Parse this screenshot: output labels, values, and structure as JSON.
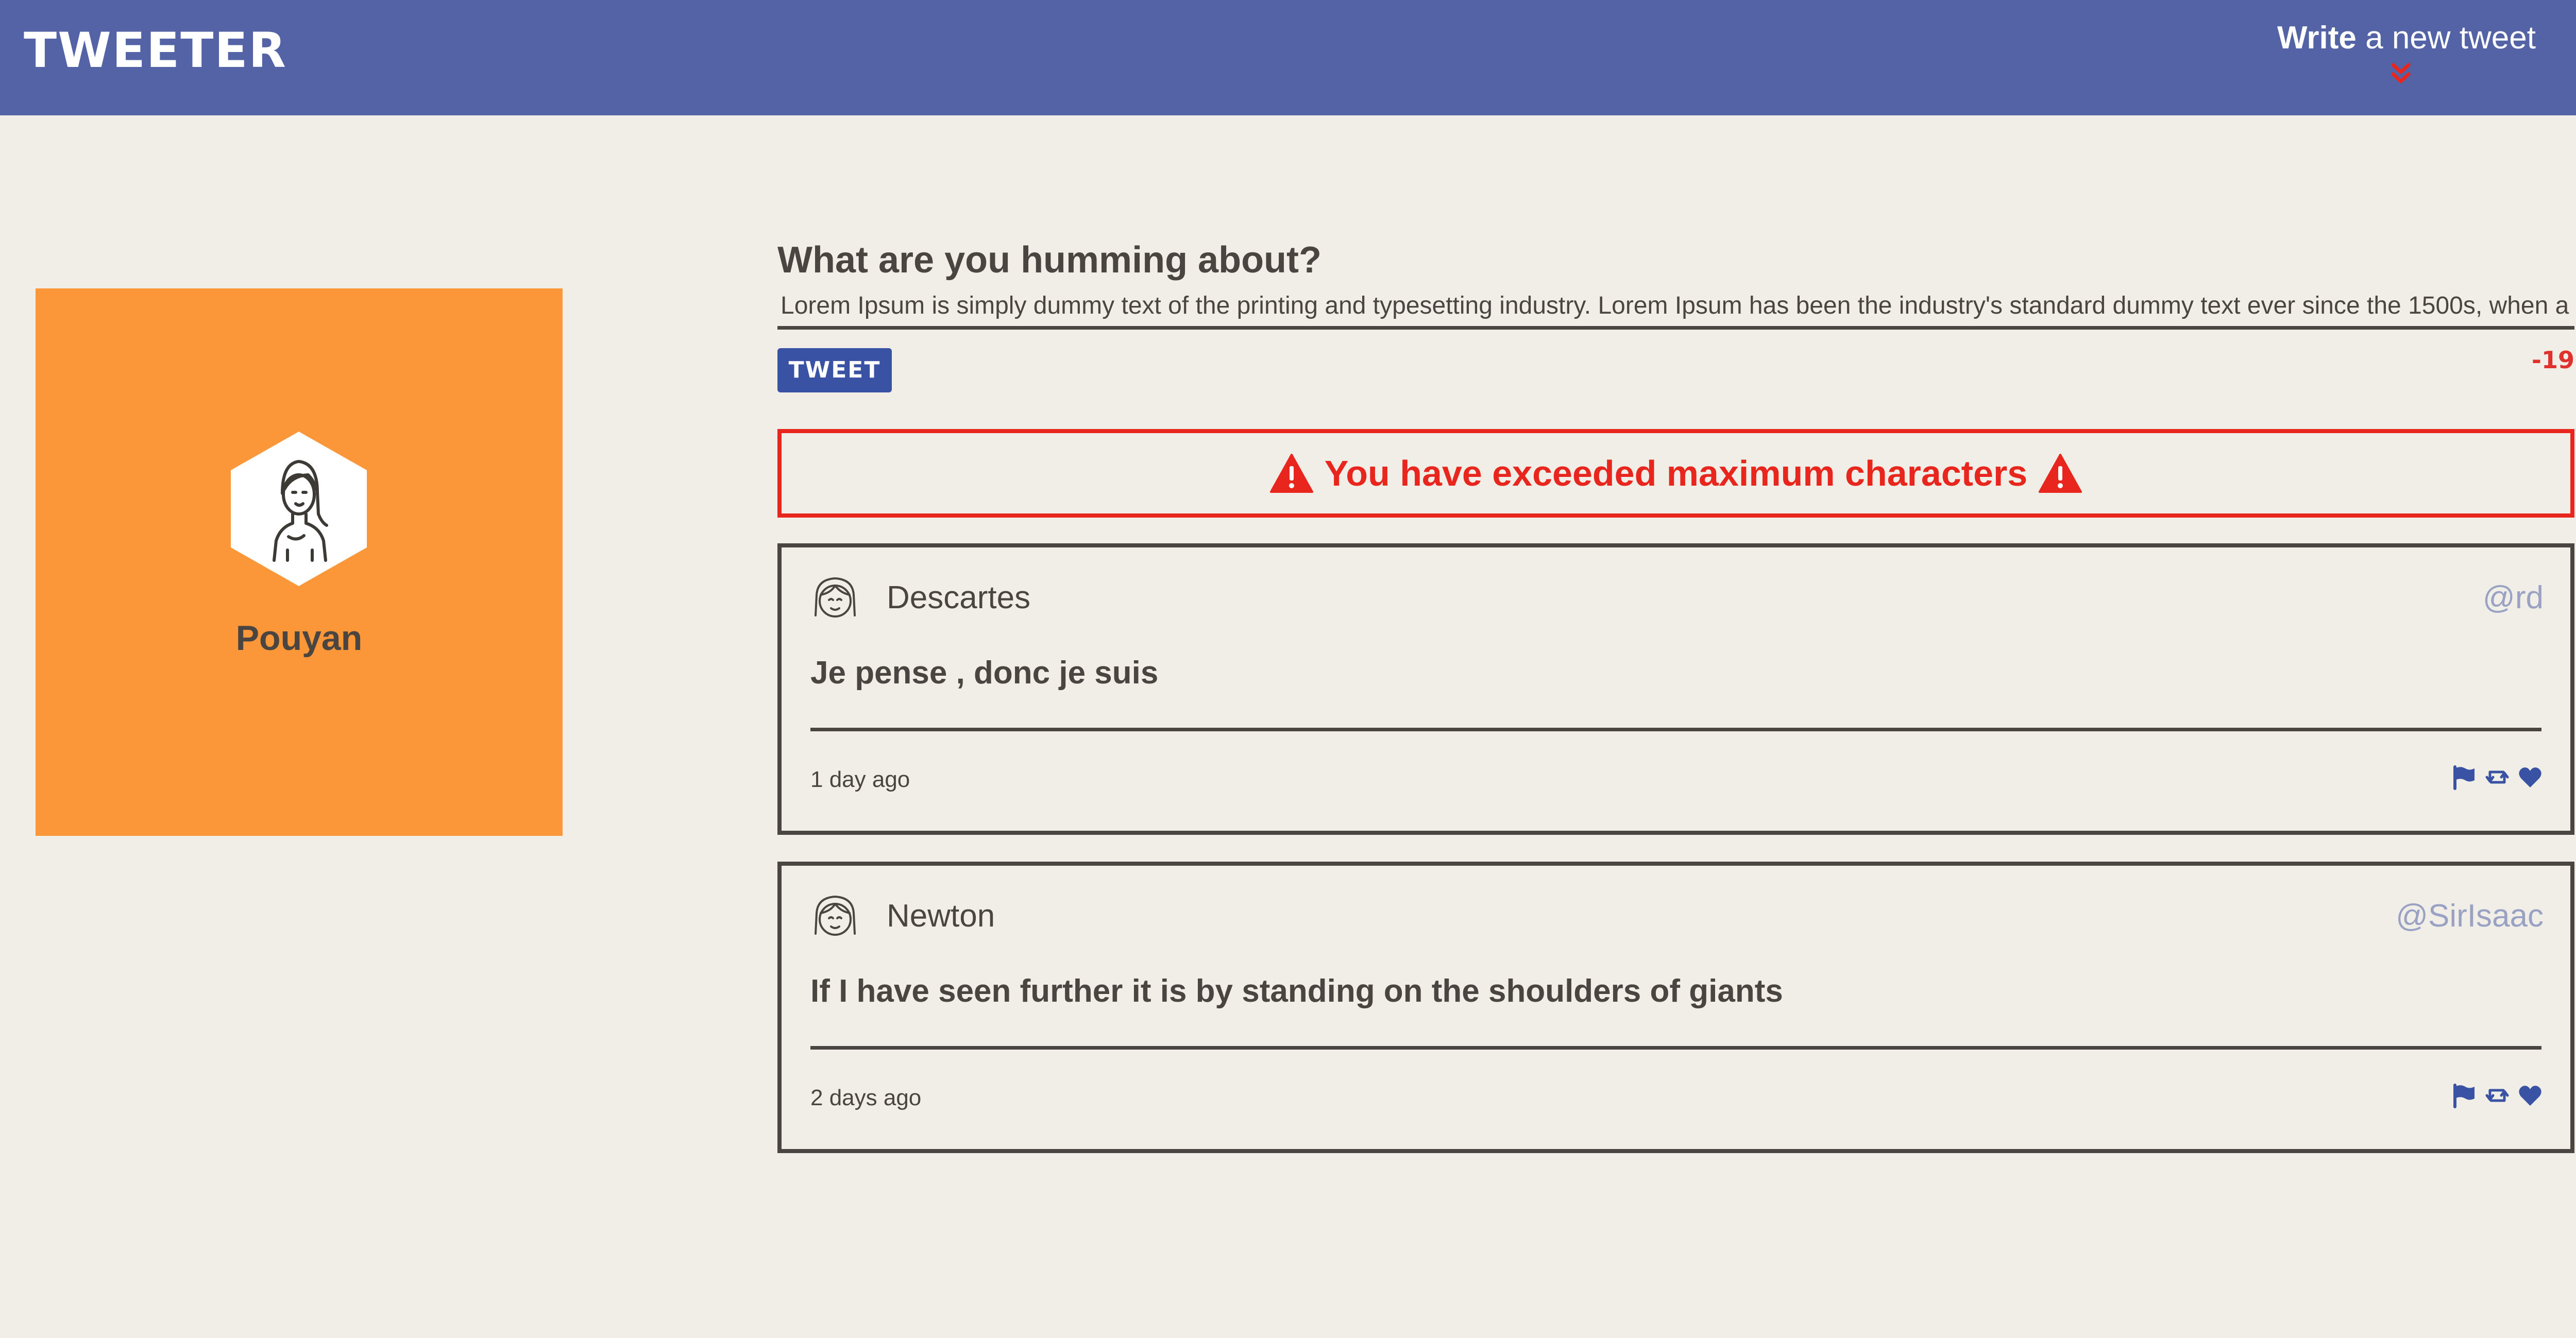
{
  "header": {
    "brand": "TWEETER",
    "compose_toggle_bold": "Write",
    "compose_toggle_rest": " a new tweet",
    "toggle_icon": "chevron-double-down-icon"
  },
  "profile": {
    "name": "Pouyan",
    "avatar_icon": "user-avatar-icon",
    "card_color": "#fb9639"
  },
  "compose": {
    "heading": "What are you humming about?",
    "input_value": "Lorem Ipsum is simply dummy text of the printing and typesetting industry. Lorem Ipsum has been the industry's standard dummy text ever since the 1500s, when a",
    "button_label": "TWEET",
    "counter": "-19"
  },
  "error": {
    "message": "You have exceeded maximum characters",
    "icon": "warning-icon",
    "color": "#e8261d"
  },
  "tweets": [
    {
      "author": "Descartes",
      "handle": "@rd",
      "content": "Je pense , donc je suis",
      "time": "1 day ago"
    },
    {
      "author": "Newton",
      "handle": "@SirIsaac",
      "content": "If I have seen further it is by standing on the shoulders of giants",
      "time": "2 days ago"
    }
  ],
  "colors": {
    "navbar": "#5363a6",
    "accent": "#3a52a4",
    "background": "#f1eee8",
    "text": "#4a4540",
    "handle": "#9aa2c4",
    "error": "#e8261d"
  }
}
